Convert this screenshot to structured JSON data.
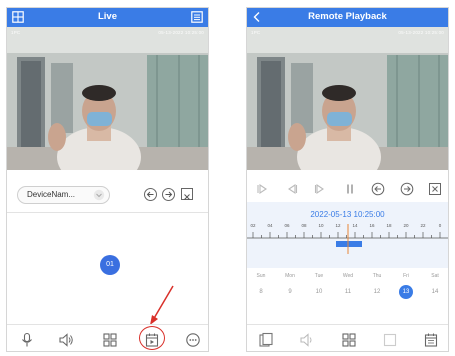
{
  "live": {
    "title": "Live",
    "osd_left": "1PC",
    "osd_right": "05-13-2022 10:25:00",
    "device_select": "DeviceNam...",
    "channel_badge": "01",
    "accent": "#3a7ce6",
    "highlight_color": "#d9302a",
    "toolbar_icons": [
      "microphone-icon",
      "speaker-icon",
      "grid-icon",
      "playback-icon",
      "more-icon"
    ]
  },
  "playback": {
    "title": "Remote Playback",
    "osd_left": "1PC",
    "osd_right": "05-13-2022 10:25:00",
    "datetime": "2022-05-13 10:25:00",
    "ruler_ticks": [
      "02",
      "04",
      "06",
      "08",
      "10",
      "12",
      "14",
      "16",
      "18",
      "20",
      "22",
      "0"
    ],
    "week": [
      {
        "day": "Sun",
        "date": "8"
      },
      {
        "day": "Mon",
        "date": "9"
      },
      {
        "day": "Tue",
        "date": "10"
      },
      {
        "day": "Wed",
        "date": "11"
      },
      {
        "day": "Thu",
        "date": "12"
      },
      {
        "day": "Fri",
        "date": "13"
      },
      {
        "day": "Sat",
        "date": "14"
      }
    ],
    "selected_date": "13",
    "toolbar_icons": [
      "channel-icon",
      "speaker-icon",
      "grid-icon",
      "record-icon",
      "calendar-icon"
    ]
  }
}
